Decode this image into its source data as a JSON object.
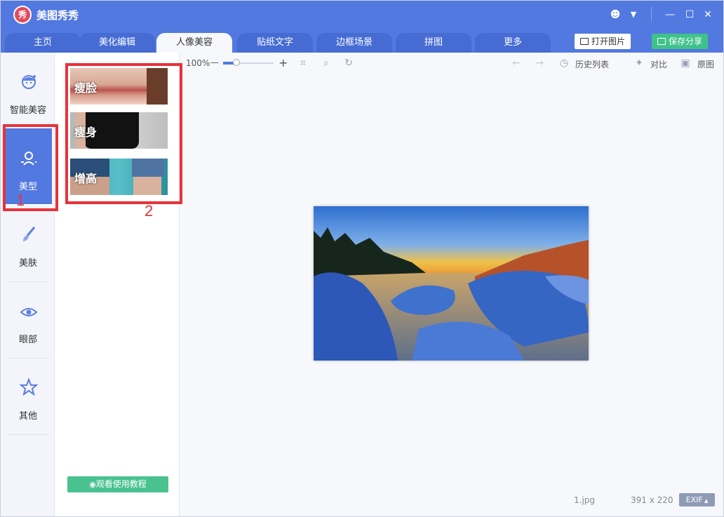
{
  "app": {
    "title": "美图秀秀",
    "logo_text": "秀"
  },
  "window_controls": {
    "chat": "☻",
    "menu": "▼",
    "minimize": "—",
    "maximize": "☐",
    "close": "✕"
  },
  "tabs": [
    {
      "label": "主页"
    },
    {
      "label": "美化编辑"
    },
    {
      "label": "人像美容",
      "active": true
    },
    {
      "label": "贴纸文字"
    },
    {
      "label": "边框场景"
    },
    {
      "label": "拼图"
    },
    {
      "label": "更多"
    }
  ],
  "actions": {
    "open_label": "打开图片",
    "save_label": "保存分享"
  },
  "sidebar": {
    "items": [
      {
        "label": "智能美容",
        "icon": "smart-beauty-icon"
      },
      {
        "label": "美型",
        "icon": "body-shape-icon",
        "active": true
      },
      {
        "label": "美肤",
        "icon": "brush-icon"
      },
      {
        "label": "眼部",
        "icon": "eye-icon"
      },
      {
        "label": "其他",
        "icon": "star-icon"
      }
    ]
  },
  "panel": {
    "options": [
      {
        "label": "瘦脸"
      },
      {
        "label": "瘦身"
      },
      {
        "label": "增高"
      }
    ],
    "tutorial_label": "观看使用教程"
  },
  "annotations": {
    "box1": "1",
    "box2": "2"
  },
  "toolbar": {
    "zoom": "100%",
    "zoom_out": "—",
    "zoom_in": "+",
    "history_label": "历史列表",
    "compare_label": "对比",
    "original_label": "原图"
  },
  "status": {
    "filename": "1.jpg",
    "dimensions": "391 x 220",
    "exif_label": "EXIF"
  },
  "colors": {
    "brand_blue": "#5279e0",
    "green": "#3fc28a",
    "annotation_red": "#e8323a"
  }
}
